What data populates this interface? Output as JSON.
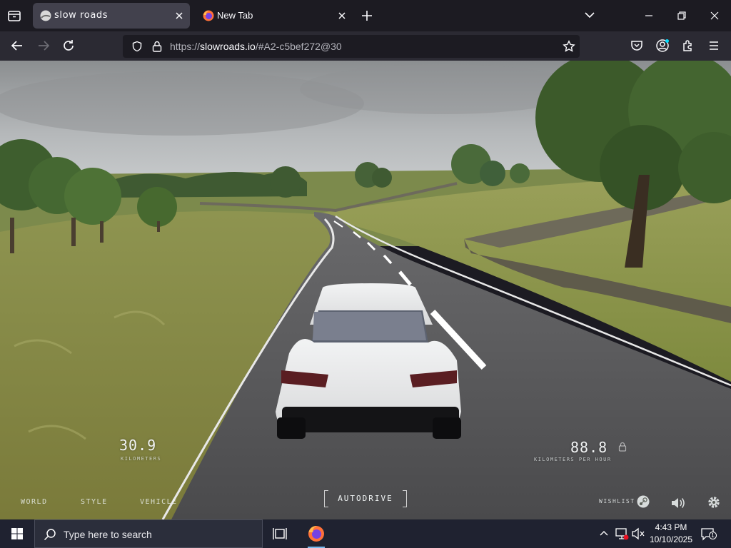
{
  "browser": {
    "tabs": [
      {
        "title": "slow roads",
        "active": true
      },
      {
        "title": "New Tab",
        "active": false
      }
    ],
    "url": {
      "scheme": "https://",
      "host": "slowroads.io",
      "rest": "/#A2-c5bef272@30"
    }
  },
  "game": {
    "distance": {
      "value": "30.9",
      "unit": "KILOMETERS"
    },
    "speed": {
      "value": "88.8",
      "unit": "KILOMETERS PER HOUR"
    },
    "menu": {
      "world": "WORLD",
      "style": "STYLE",
      "vehicle": "VEHICLE"
    },
    "autodrive_label": "AUTODRIVE",
    "wishlist_label": "WISHLIST"
  },
  "taskbar": {
    "search_placeholder": "Type here to search",
    "time": "4:43 PM",
    "date": "10/10/2025",
    "notification_count": "1"
  },
  "colors": {
    "sky": "#b9bcbe",
    "grass": "#8c8d4a",
    "road": "#545456",
    "car": "#e9eaeb",
    "taskbar": "#1f2230"
  }
}
